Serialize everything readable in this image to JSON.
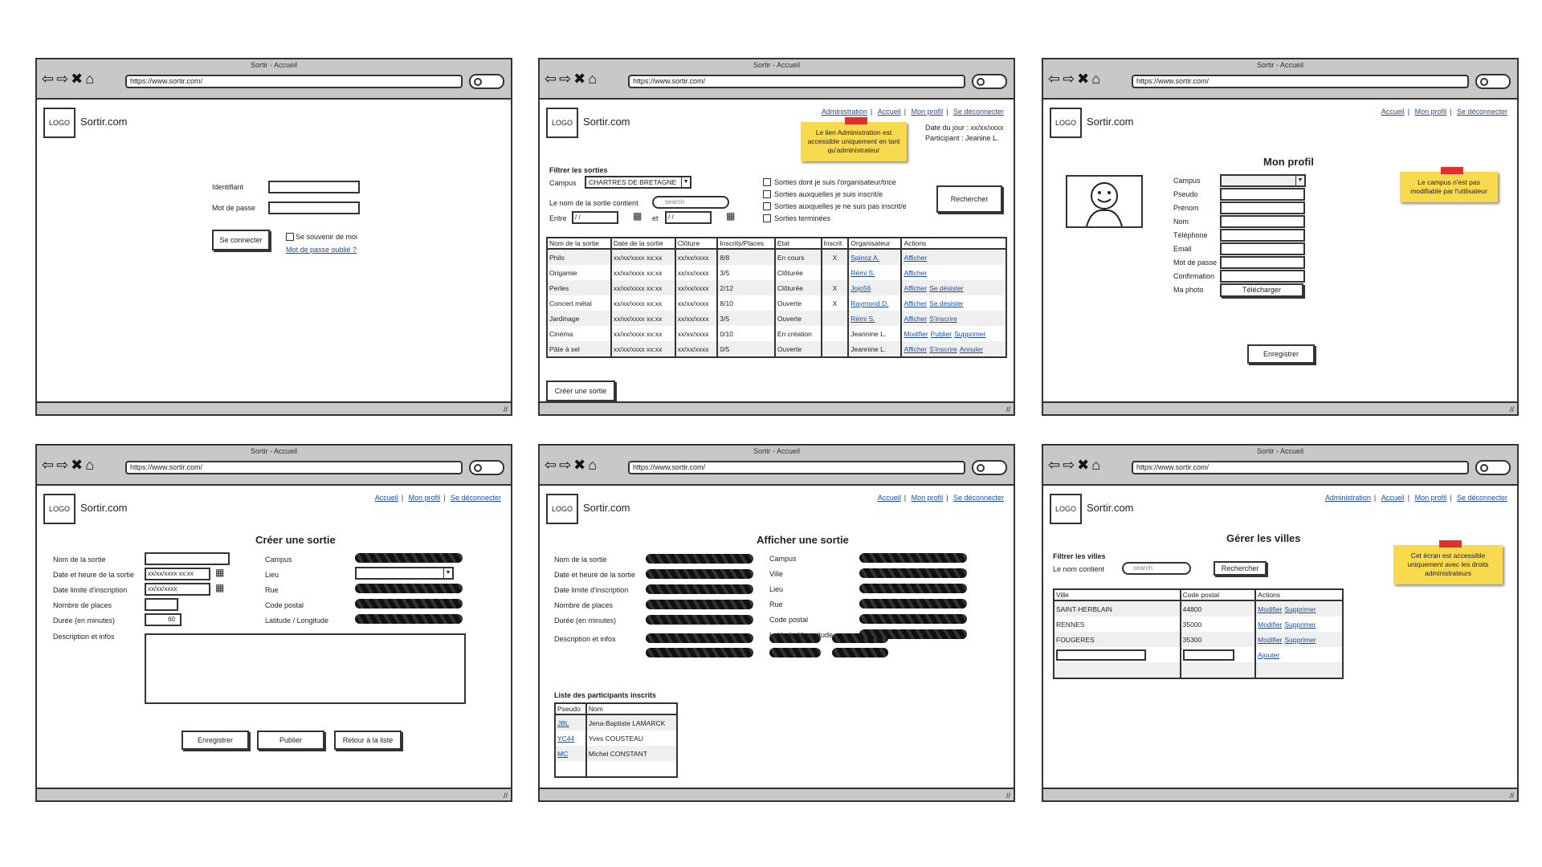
{
  "browser": {
    "title": "Sortir - Accueil",
    "url": "https://www.sortir.com/"
  },
  "brand": "Sortir.com",
  "logo_text": "LOGO",
  "nav": {
    "admin": "Administration",
    "home": "Accueil",
    "profile": "Mon profil",
    "logout": "Se déconnecter"
  },
  "login": {
    "id_label": "Identifiant",
    "pwd_label": "Mot de passe",
    "submit": "Se connecter",
    "remember": "Se souvenir de moi",
    "forgot": "Mot de passe oublié ?"
  },
  "home": {
    "sticky": "Le lien Administration est accessible uniquement en tant qu'administrateur",
    "date_label": "Date du jour : xx/xx/xxxx",
    "participant_label": "Participant : Jeanine L.",
    "filter_title": "Filtrer les sorties",
    "campus_label": "Campus",
    "campus_value": "CHARTRES DE BRETAGNE",
    "name_label": "Le nom de la sortie contient",
    "search_placeholder": "search",
    "between_label": "Entre",
    "and_label": "et",
    "date_placeholder": "/ /",
    "checkboxes": [
      "Sorties dont je suis l'organisateur/trice",
      "Sorties auxquelles je suis inscrit/e",
      "Sorties auxquelles je ne suis pas inscrit/e",
      "Sorties terminées"
    ],
    "search_button": "Rechercher",
    "create_button": "Créer une sortie",
    "columns": [
      "Nom de la sortie",
      "Date de la sortie",
      "Clôture",
      "Inscrits/Places",
      "Etat",
      "Inscrit",
      "Organisateur",
      "Actions"
    ],
    "rows": [
      {
        "name": "Philo",
        "date": "xx/xx/xxxx xx:xx",
        "close": "xx/xx/xxxx",
        "places": "8/8",
        "state": "En cours",
        "reg": "X",
        "org": "Spinoz A.",
        "org_link": true,
        "actions": [
          "Afficher"
        ]
      },
      {
        "name": "Origamie",
        "date": "xx/xx/xxxx xx:xx",
        "close": "xx/xx/xxxx",
        "places": "3/5",
        "state": "Clôturée",
        "reg": "",
        "org": "Rémi S.",
        "org_link": true,
        "actions": [
          "Afficher"
        ]
      },
      {
        "name": "Perles",
        "date": "xx/xx/xxxx xx:xx",
        "close": "xx/xx/xxxx",
        "places": "2/12",
        "state": "Clôturée",
        "reg": "X",
        "org": "Jojo56",
        "org_link": true,
        "actions": [
          "Afficher",
          "Se désister"
        ]
      },
      {
        "name": "Concert métal",
        "date": "xx/xx/xxxx xx:xx",
        "close": "xx/xx/xxxx",
        "places": "8/10",
        "state": "Ouverte",
        "reg": "X",
        "org": "Raymond D.",
        "org_link": true,
        "actions": [
          "Afficher",
          "Se désister"
        ]
      },
      {
        "name": "Jardinage",
        "date": "xx/xx/xxxx xx:xx",
        "close": "xx/xx/xxxx",
        "places": "3/5",
        "state": "Ouverte",
        "reg": "",
        "org": "Rémi S.",
        "org_link": true,
        "actions": [
          "Afficher",
          "S'inscrire"
        ]
      },
      {
        "name": "Cinéma",
        "date": "xx/xx/xxxx xx:xx",
        "close": "xx/xx/xxxx",
        "places": "0/10",
        "state": "En création",
        "reg": "",
        "org": "Jeannine L.",
        "org_link": false,
        "actions": [
          "Modifier",
          "Publier",
          "Supprimer"
        ]
      },
      {
        "name": "Pâte à sel",
        "date": "xx/xx/xxxx xx:xx",
        "close": "xx/xx/xxxx",
        "places": "0/5",
        "state": "Ouverte",
        "reg": "",
        "org": "Jeannine L.",
        "org_link": false,
        "actions": [
          "Afficher",
          "S'inscrire",
          "Annuler"
        ]
      }
    ]
  },
  "profile": {
    "title": "Mon profil",
    "sticky": "Le campus n'est pas modifiable par l'utilisateur",
    "fields": [
      "Campus",
      "Pseudo",
      "Prénom",
      "Nom",
      "Téléphone",
      "Email",
      "Mot de passe",
      "Confirmation",
      "Ma photo"
    ],
    "upload": "Télécharger",
    "save": "Enregistrer"
  },
  "create": {
    "title": "Créer une sortie",
    "left_fields": [
      "Nom de la sortie",
      "Date et heure de la sortie",
      "Date limite d'inscription",
      "Nombre de places",
      "Durée (en minutes)",
      "Description et infos"
    ],
    "right_fields": [
      "Campus",
      "Lieu",
      "Rue",
      "Code postal",
      "Latitude / Longitude"
    ],
    "datetime_placeholder": "xx/xx/xxxx xx:xx",
    "date_placeholder": "xx/xx/xxxx",
    "duration_value": "60",
    "buttons": [
      "Enregistrer",
      "Publier",
      "Retour à la liste"
    ]
  },
  "show": {
    "title": "Afficher une sortie",
    "left_fields": [
      "Nom de la sortie",
      "Date et heure de la sortie",
      "Date limite d'inscription",
      "Nombre de places",
      "Durée (en minutes)",
      "Description et infos"
    ],
    "right_fields": [
      "Campus",
      "Ville",
      "Lieu",
      "Rue",
      "Code postal",
      "Latitude / Longitude"
    ],
    "participants_title": "Liste des participants inscrits",
    "participants_cols": [
      "Pseudo",
      "Nom"
    ],
    "participants": [
      {
        "pseudo": "JBL",
        "name": "Jena-Baptiste LAMARCK"
      },
      {
        "pseudo": "YC44",
        "name": "Yves COUSTEAU"
      },
      {
        "pseudo": "MC",
        "name": "Michel CONSTANT"
      }
    ]
  },
  "cities": {
    "title": "Gérer les villes",
    "sticky": "Cet écran est accessible uniquement avec les droits administrateurs",
    "filter_title": "Filtrer les villes",
    "name_label": "Le nom contient",
    "search_placeholder": "search",
    "search_button": "Rechercher",
    "columns": [
      "Ville",
      "Code postal",
      "Actions"
    ],
    "rows": [
      {
        "city": "SAINT-HERBLAIN",
        "zip": "44800"
      },
      {
        "city": "RENNES",
        "zip": "35000"
      },
      {
        "city": "FOUGERES",
        "zip": "35300"
      }
    ],
    "edit": "Modifier",
    "delete": "Supprimer",
    "add": "Ajouter"
  }
}
